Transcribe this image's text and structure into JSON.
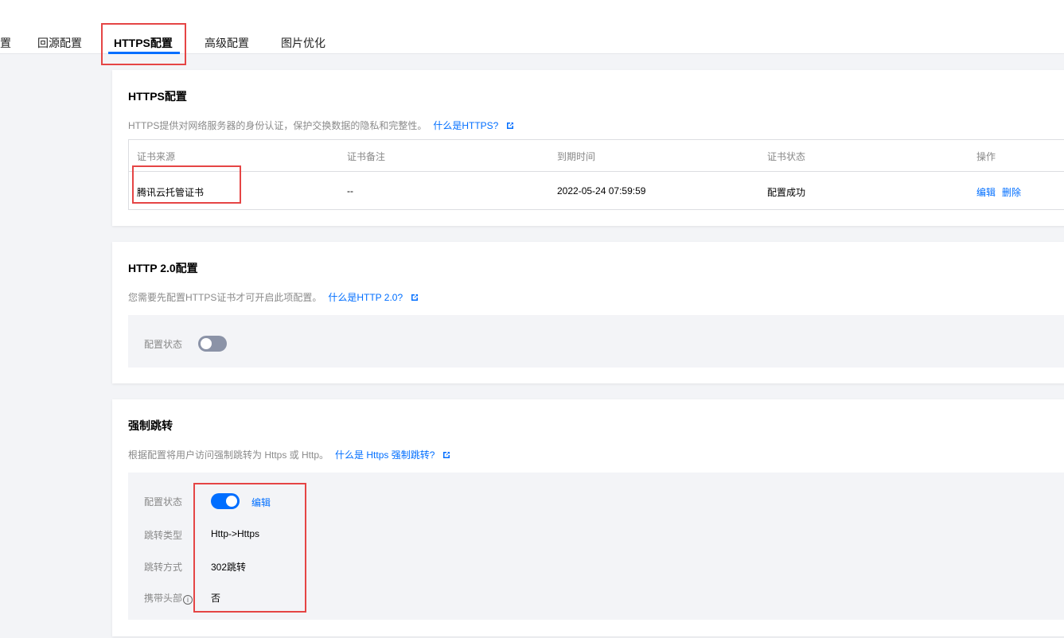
{
  "tabs": [
    {
      "label": "置"
    },
    {
      "label": "回源配置"
    },
    {
      "label": "HTTPS配置"
    },
    {
      "label": "高级配置"
    },
    {
      "label": "图片优化"
    }
  ],
  "https": {
    "title": "HTTPS配置",
    "desc": "HTTPS提供对网络服务器的身份认证，保护交换数据的隐私和完整性。",
    "link": "什么是HTTPS?",
    "columns": [
      "证书来源",
      "证书备注",
      "到期时间",
      "证书状态",
      "操作"
    ],
    "row": {
      "source": "腾讯云托管证书",
      "note": "--",
      "expire": "2022-05-24 07:59:59",
      "status": "配置成功",
      "edit": "编辑",
      "delete": "删除"
    }
  },
  "http2": {
    "title": "HTTP 2.0配置",
    "desc": "您需要先配置HTTPS证书才可开启此项配置。",
    "link": "什么是HTTP 2.0?",
    "status_label": "配置状态",
    "enabled": false
  },
  "redirect": {
    "title": "强制跳转",
    "desc": "根据配置将用户访问强制跳转为 Https 或 Http。",
    "link": "什么是 Https 强制跳转?",
    "status_label": "配置状态",
    "enabled": true,
    "edit": "编辑",
    "type_label": "跳转类型",
    "type_value": "Http->Https",
    "method_label": "跳转方式",
    "method_value": "302跳转",
    "header_label": "携带头部",
    "header_value": "否",
    "info_glyph": "i"
  },
  "colors": {
    "accent": "#006eff",
    "highlight": "#e54545",
    "toggle_off": "#8b93a7"
  }
}
